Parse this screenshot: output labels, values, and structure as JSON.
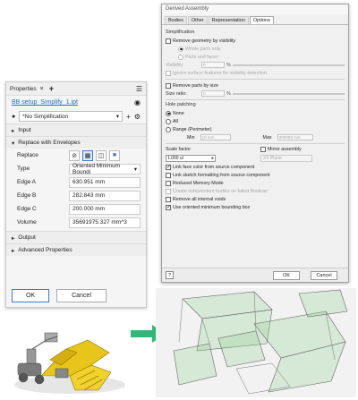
{
  "properties": {
    "tab_title": "Properties",
    "close_glyph": "×",
    "add_tab_glyph": "+",
    "file_name": "BB setup_Simplify_1.ipt",
    "simplification": "*No Simplification",
    "sections": {
      "input": "Input",
      "replace": "Replace with Envelopes",
      "output": "Output",
      "advanced": "Advanced Properties"
    },
    "fields": {
      "replace_label": "Replace",
      "type_label": "Type",
      "type_value": "Oriented Minimum Boundi",
      "edge_a_label": "Edge A",
      "edge_a_value": "630.951 mm",
      "edge_b_label": "Edge B",
      "edge_b_value": "282.843 mm",
      "edge_c_label": "Edge C",
      "edge_c_value": "200.000 mm",
      "volume_label": "Volume",
      "volume_value": "35691975.327 mm^3"
    },
    "ok_label": "OK",
    "cancel_label": "Cancel"
  },
  "dialog": {
    "title": "Derived Assembly",
    "tabs": [
      "Bodies",
      "Other",
      "Representation",
      "Options"
    ],
    "active_tab": "Options",
    "simplification_group": "Simplification",
    "remove_by_visibility": "Remove geometry by visibility",
    "whole_parts_only": "Whole parts only",
    "parts_and_faces": "Parts and faces",
    "visibility_label": "Visibility:",
    "visibility_value": "0",
    "percent": "%",
    "ignore_surface": "Ignore surface features for visibility detection",
    "remove_by_size": "Remove parts by size",
    "size_ratio_label": "Size ratio:",
    "size_ratio_value": "0",
    "hole_patching_group": "Hole patching",
    "hole_none": "None",
    "hole_all": "All",
    "hole_range": "Range (Perimeter)",
    "min_label": "Min",
    "min_value": "10 mm",
    "max_label": "Max",
    "max_value": "999999 mm",
    "scale_factor_label": "Scale factor",
    "scale_factor_value": "1.000 ul",
    "mirror_assembly": "Mirror assembly",
    "mirror_plane": "XY Plane",
    "link_face_color": "Link face color from source component",
    "link_sketch": "Link sketch formatting from source component",
    "reduced_memory": "Reduced Memory Mode",
    "create_independent": "Create independent bodies on failed Boolean",
    "remove_internal_voids": "Remove all internal voids",
    "use_oriented_box": "Use oriented minimum bounding box",
    "ok_label": "OK",
    "cancel_label": "Cancel"
  },
  "colors": {
    "accent": "#3a7bd5",
    "link": "#1d6fd1",
    "arrow": "#2fb876",
    "model_yellow": "#e8c51a",
    "box_green": "#8fcf8f"
  },
  "icons": [
    "eye-icon",
    "gear-icon",
    "menu-icon",
    "chevron-icon",
    "help-icon",
    "arrow-right-icon"
  ]
}
